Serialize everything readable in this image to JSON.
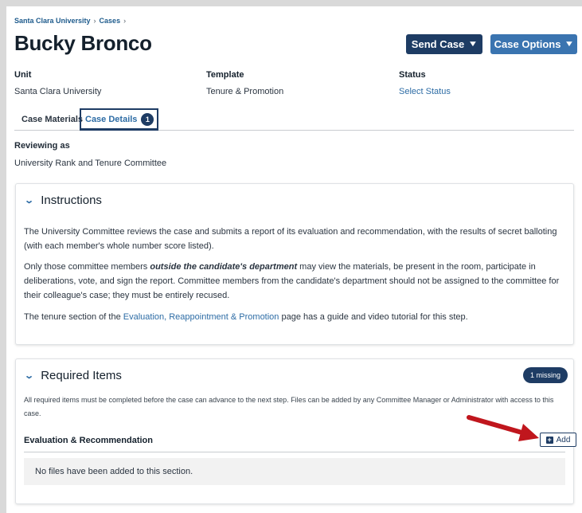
{
  "breadcrumb": {
    "items": [
      "Santa Clara University",
      "Cases"
    ],
    "separator": "›"
  },
  "header": {
    "title": "Bucky Bronco",
    "send_label": "Send Case",
    "options_label": "Case Options"
  },
  "meta": {
    "unit_label": "Unit",
    "unit_value": "Santa Clara University",
    "template_label": "Template",
    "template_value": "Tenure & Promotion",
    "status_label": "Status",
    "status_value": "Select Status"
  },
  "tabs": {
    "materials_label": "Case Materials",
    "details_label": "Case Details",
    "details_badge": "1"
  },
  "reviewing": {
    "label": "Reviewing as",
    "value": "University Rank and Tenure Committee"
  },
  "instructions": {
    "title": "Instructions",
    "p1": "The University Committee reviews the case and submits a report of its evaluation and recommendation, with the results of secret balloting (with each member's whole number score listed).",
    "p2_pre": "Only those committee members ",
    "p2_emph": "outside the candidate's department",
    "p2_post": " may view the materials, be present in the room, participate in deliberations, vote, and sign the report. Committee members from the candidate's department should not be assigned to the committee for their colleague's case; they must be entirely recused.",
    "p3_pre": "The tenure section of the ",
    "p3_link": "Evaluation, Reappointment & Promotion",
    "p3_post": " page has a guide and video tutorial for this step."
  },
  "required": {
    "title": "Required Items",
    "badge": "1 missing",
    "description": "All required items must be completed before the case can advance to the next step. Files can be added by any Committee Manager or Administrator with access to this case.",
    "section_title": "Evaluation & Recommendation",
    "add_label": "Add",
    "empty_text": "No files have been added to this section."
  },
  "colors": {
    "navy": "#1e3c64",
    "blue": "#3a74b0",
    "link": "#2d6ca5",
    "arrow": "#c0161d"
  }
}
